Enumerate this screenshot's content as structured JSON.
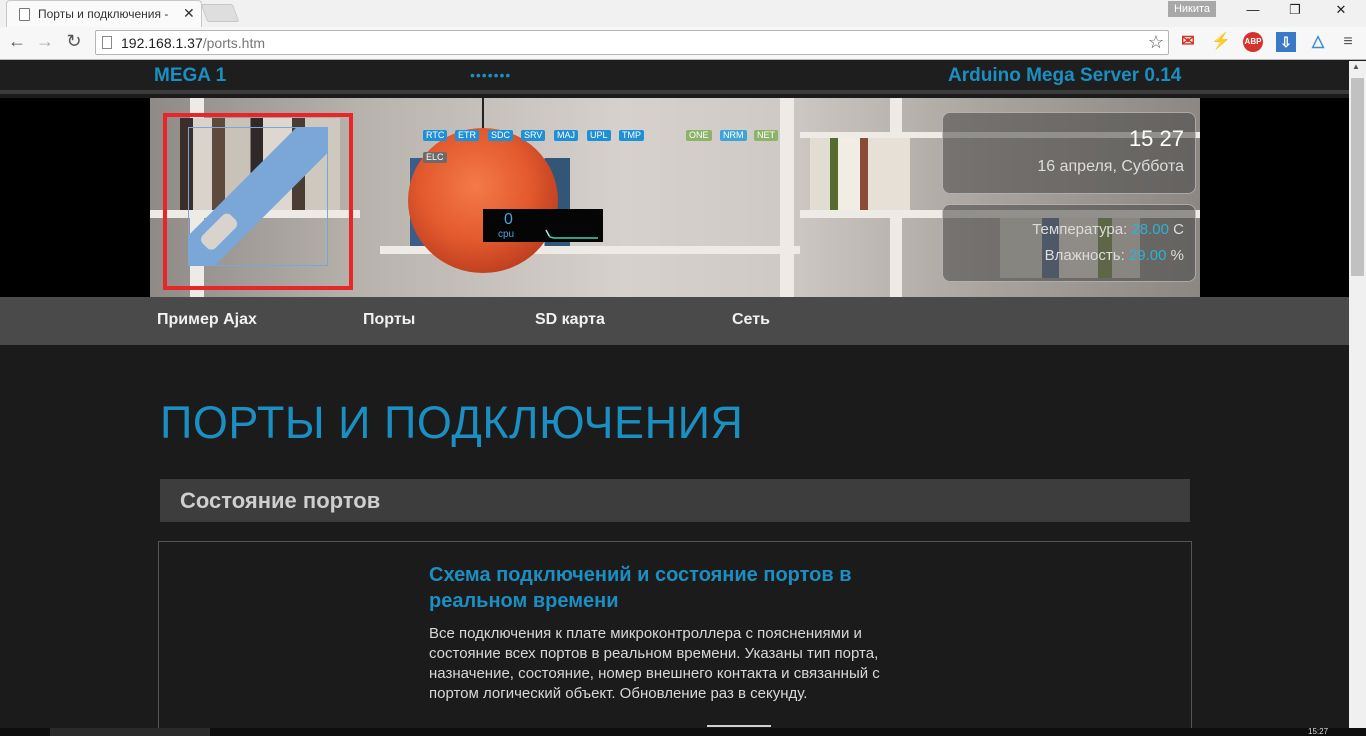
{
  "browser": {
    "tab_title": "Порты и подключения -",
    "tab_close": "✕",
    "user_name": "Никита",
    "window_controls": {
      "minimize": "—",
      "restore": "❐",
      "close": "✕"
    },
    "url_host": "192.168.1.37",
    "url_path": "/ports.htm",
    "extensions": [
      "gmail-icon",
      "lightning-icon",
      "adblock-icon",
      "download-icon",
      "drive-icon",
      "menu-icon"
    ],
    "adblock_label": "ABP"
  },
  "header": {
    "brand": "MEGA 1",
    "dots": "•••••••",
    "server_title": "Arduino Mega Server 0.14"
  },
  "banner": {
    "status_tags": [
      {
        "label": "RTC",
        "color": "#1f8fd6"
      },
      {
        "label": "ETR",
        "color": "#1f8fd6"
      },
      {
        "label": "SDC",
        "color": "#1f8fd6"
      },
      {
        "label": "SRV",
        "color": "#1f8fd6"
      },
      {
        "label": "MAJ",
        "color": "#1f8fd6"
      },
      {
        "label": "UPL",
        "color": "#1f8fd6"
      },
      {
        "label": "TMP",
        "color": "#1f8fd6"
      },
      {
        "label": "ONE",
        "color": "#8db36a"
      },
      {
        "label": "NRM",
        "color": "#3fa3d8"
      },
      {
        "label": "NET",
        "color": "#8db36a"
      },
      {
        "label": "ELC",
        "color": "#6b6b6b"
      }
    ],
    "cpu": {
      "value": "0",
      "label": "cpu"
    },
    "clock": {
      "time": "15 27",
      "date": "16 апреля, Суббота"
    },
    "temperature": {
      "label": "Температура:",
      "value": "28.00",
      "unit": "C"
    },
    "humidity": {
      "label": "Влажность:",
      "value": "29.00",
      "unit": "%"
    }
  },
  "nav": {
    "items": [
      "Пример Ajax",
      "Порты",
      "SD карта",
      "Сеть"
    ]
  },
  "main": {
    "page_title": "ПОРТЫ И ПОДКЛЮЧЕНИЯ",
    "section_title": "Состояние портов",
    "card_heading": "Схема подключений и состояние портов в реальном времени",
    "card_text": "Все подключения к плате микроконтроллера с пояснениями и состояние всех портов в реальном времени. Указаны тип порта, назначение, состояние, номер внешнего контакта и связанный с портом логический объект. Обновление раз в секунду."
  },
  "taskbar": {
    "clock": "15:27"
  },
  "colors": {
    "accent": "#1b8ec2",
    "sensor_value": "#2bb3d6",
    "logo_frame": "#e8262a",
    "logo_blue": "#7aa7d8"
  }
}
